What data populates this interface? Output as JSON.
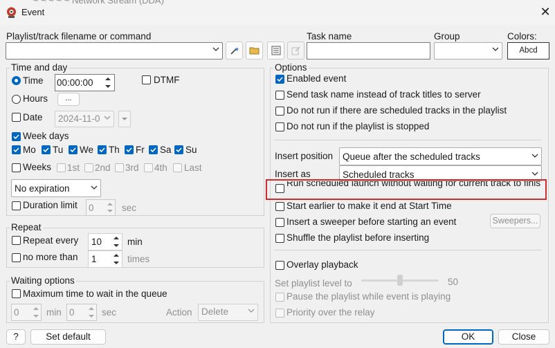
{
  "window": {
    "title": "Event",
    "ghost_text": "~  ~ ~ ~ ~        Network Stream (DDA)"
  },
  "top": {
    "playlist_label": "Playlist/track filename or command",
    "playlist_value": "",
    "task_label": "Task name",
    "task_value": "",
    "group_label": "Group",
    "group_value": "",
    "colors_label": "Colors:",
    "colors_sample": "Abcd"
  },
  "time_day": {
    "legend": "Time and day",
    "time_label": "Time",
    "time_value": "00:00:00",
    "dtmf_label": "DTMF",
    "hours_label": "Hours",
    "hours_button": "...",
    "date_label": "Date",
    "date_value": "2024-11-0",
    "week_days_label": "Week days",
    "days": [
      "Mo",
      "Tu",
      "We",
      "Th",
      "Fr",
      "Sa",
      "Su"
    ],
    "weeks_label": "Weeks",
    "weeks": [
      "1st",
      "2nd",
      "3rd",
      "4th",
      "Last"
    ],
    "expiration_value": "No expiration",
    "duration_label": "Duration limit",
    "duration_value": "0",
    "duration_unit": "sec"
  },
  "repeat": {
    "legend": "Repeat",
    "every_label": "Repeat every",
    "every_value": "10",
    "every_unit": "min",
    "no_more_label": "no more than",
    "no_more_value": "1",
    "no_more_unit": "times"
  },
  "waiting": {
    "legend": "Waiting options",
    "max_label": "Maximum time to wait in the queue",
    "min_value": "0",
    "min_unit": "min",
    "sec_value": "0",
    "sec_unit": "sec",
    "action_label": "Action",
    "action_value": "Delete"
  },
  "options": {
    "legend": "Options",
    "enabled": "Enabled event",
    "send_task_name": "Send task name instead of track titles to server",
    "no_run_scheduled": "Do not run if there are scheduled tracks in the playlist",
    "no_run_stopped": "Do not run if the playlist is stopped",
    "insert_position_label": "Insert position",
    "insert_position_value": "Queue after the scheduled tracks",
    "insert_as_label": "Insert as",
    "insert_as_value": "Scheduled tracks",
    "run_scheduled": "Run scheduled launch without waiting for current track to finish",
    "start_earlier": "Start earlier to make it end at Start Time",
    "insert_sweeper": "Insert a sweeper before starting an event",
    "sweepers_button": "Sweepers...",
    "shuffle": "Shuffle the playlist before inserting",
    "overlay": "Overlay playback",
    "set_level_label": "Set playlist level to",
    "set_level_value": "50",
    "set_level_fraction": 0.5,
    "pause_playlist": "Pause the playlist while event is playing",
    "priority": "Priority over the relay"
  },
  "bottom": {
    "help": "?",
    "set_default": "Set default",
    "ok": "OK",
    "close": "Close"
  },
  "colors": {
    "accent": "#0067c0",
    "highlight": "#d22b2b"
  }
}
